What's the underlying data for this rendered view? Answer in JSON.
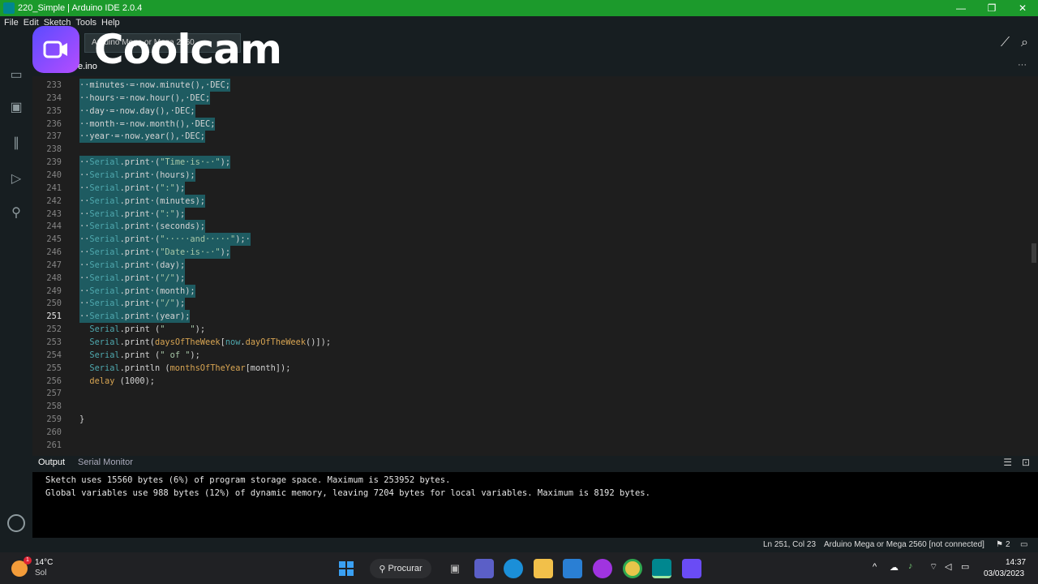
{
  "window": {
    "title": "220_Simple | Arduino IDE 2.0.4",
    "minimize": "—",
    "maximize": "❐",
    "close": "✕"
  },
  "menu": [
    "File",
    "Edit",
    "Sketch",
    "Tools",
    "Help"
  ],
  "toolbar": {
    "board_selected": "Arduino Mega or Mega 2560"
  },
  "watermark": {
    "text": "Coolcam"
  },
  "tab": {
    "label": "e.ino",
    "more": "···"
  },
  "editor": {
    "active_line": 251,
    "lines": [
      {
        "n": "233",
        "sel": true,
        "parts": [
          [
            "··minutes·=·",
            ""
          ],
          [
            "now",
            ""
          ],
          [
            ".minute(),·DEC;",
            ""
          ]
        ]
      },
      {
        "n": "234",
        "sel": true,
        "parts": [
          [
            "··hours·=·",
            ""
          ],
          [
            "now",
            ""
          ],
          [
            ".hour(),·DEC;",
            ""
          ]
        ]
      },
      {
        "n": "235",
        "sel": true,
        "parts": [
          [
            "··day·=·",
            ""
          ],
          [
            "now",
            ""
          ],
          [
            ".day(),·DEC;",
            ""
          ]
        ]
      },
      {
        "n": "236",
        "sel": true,
        "parts": [
          [
            "··month·=·",
            ""
          ],
          [
            "now",
            ""
          ],
          [
            ".month(),·DEC;",
            ""
          ]
        ]
      },
      {
        "n": "237",
        "sel": true,
        "parts": [
          [
            "··year·=·",
            ""
          ],
          [
            "now",
            ""
          ],
          [
            ".year(),·DEC;",
            ""
          ]
        ]
      },
      {
        "n": "238",
        "sel": true,
        "parts": [
          [
            "",
            ""
          ]
        ]
      },
      {
        "n": "239",
        "sel": true,
        "parts": [
          [
            "··",
            ""
          ],
          [
            "Serial",
            "o"
          ],
          [
            ".print·(",
            ""
          ],
          [
            "\"Time·is·-·\"",
            "s"
          ],
          [
            ");",
            ""
          ]
        ]
      },
      {
        "n": "240",
        "sel": true,
        "parts": [
          [
            "··",
            ""
          ],
          [
            "Serial",
            "o"
          ],
          [
            ".print·(hours);",
            ""
          ]
        ]
      },
      {
        "n": "241",
        "sel": true,
        "parts": [
          [
            "··",
            ""
          ],
          [
            "Serial",
            "o"
          ],
          [
            ".print·(",
            ""
          ],
          [
            "\":\"",
            "s"
          ],
          [
            ");",
            ""
          ]
        ]
      },
      {
        "n": "242",
        "sel": true,
        "parts": [
          [
            "··",
            ""
          ],
          [
            "Serial",
            "o"
          ],
          [
            ".print·(minutes);",
            ""
          ]
        ]
      },
      {
        "n": "243",
        "sel": true,
        "parts": [
          [
            "··",
            ""
          ],
          [
            "Serial",
            "o"
          ],
          [
            ".print·(",
            ""
          ],
          [
            "\":\"",
            "s"
          ],
          [
            ");",
            ""
          ]
        ]
      },
      {
        "n": "244",
        "sel": true,
        "parts": [
          [
            "··",
            ""
          ],
          [
            "Serial",
            "o"
          ],
          [
            ".print·(seconds);",
            ""
          ]
        ]
      },
      {
        "n": "245",
        "sel": true,
        "parts": [
          [
            "··",
            ""
          ],
          [
            "Serial",
            "o"
          ],
          [
            ".print·(",
            ""
          ],
          [
            "\"·····and·····\"",
            "s"
          ],
          [
            ");·",
            ""
          ]
        ]
      },
      {
        "n": "246",
        "sel": true,
        "parts": [
          [
            "··",
            ""
          ],
          [
            "Serial",
            "o"
          ],
          [
            ".print·(",
            ""
          ],
          [
            "\"Date·is·-·\"",
            "s"
          ],
          [
            ");",
            ""
          ]
        ]
      },
      {
        "n": "247",
        "sel": true,
        "parts": [
          [
            "··",
            ""
          ],
          [
            "Serial",
            "o"
          ],
          [
            ".print·(day);",
            ""
          ]
        ]
      },
      {
        "n": "248",
        "sel": true,
        "parts": [
          [
            "··",
            ""
          ],
          [
            "Serial",
            "o"
          ],
          [
            ".print·(",
            ""
          ],
          [
            "\"/\"",
            "s"
          ],
          [
            ");",
            ""
          ]
        ]
      },
      {
        "n": "249",
        "sel": true,
        "parts": [
          [
            "··",
            ""
          ],
          [
            "Serial",
            "o"
          ],
          [
            ".print·(month);",
            ""
          ]
        ]
      },
      {
        "n": "250",
        "sel": true,
        "parts": [
          [
            "··",
            ""
          ],
          [
            "Serial",
            "o"
          ],
          [
            ".print·(",
            ""
          ],
          [
            "\"/\"",
            "s"
          ],
          [
            ");",
            ""
          ]
        ]
      },
      {
        "n": "251",
        "sel": true,
        "parts": [
          [
            "··",
            ""
          ],
          [
            "Serial",
            "o"
          ],
          [
            ".print·(year);",
            ""
          ]
        ]
      },
      {
        "n": "252",
        "sel": false,
        "parts": [
          [
            "  ",
            ""
          ],
          [
            "Serial",
            "o"
          ],
          [
            ".print (",
            ""
          ],
          [
            "\"     \"",
            "s"
          ],
          [
            ");",
            ""
          ]
        ]
      },
      {
        "n": "253",
        "sel": false,
        "parts": [
          [
            "  ",
            ""
          ],
          [
            "Serial",
            "o"
          ],
          [
            ".print(",
            ""
          ],
          [
            "daysOfTheWeek",
            "f"
          ],
          [
            "[",
            ""
          ],
          [
            "now",
            "o"
          ],
          [
            ".",
            ""
          ],
          [
            "dayOfTheWeek",
            "f"
          ],
          [
            "()]);",
            ""
          ]
        ]
      },
      {
        "n": "254",
        "sel": false,
        "parts": [
          [
            "  ",
            ""
          ],
          [
            "Serial",
            "o"
          ],
          [
            ".print (",
            ""
          ],
          [
            "\" of \"",
            "s"
          ],
          [
            ");",
            ""
          ]
        ]
      },
      {
        "n": "255",
        "sel": false,
        "parts": [
          [
            "  ",
            ""
          ],
          [
            "Serial",
            "o"
          ],
          [
            ".println (",
            ""
          ],
          [
            "monthsOfTheYear",
            "f"
          ],
          [
            "[month]);",
            ""
          ]
        ]
      },
      {
        "n": "256",
        "sel": false,
        "parts": [
          [
            "  ",
            ""
          ],
          [
            "delay",
            "f"
          ],
          [
            " (1000);",
            ""
          ]
        ]
      },
      {
        "n": "257",
        "sel": false,
        "parts": [
          [
            "",
            ""
          ]
        ]
      },
      {
        "n": "258",
        "sel": false,
        "parts": [
          [
            "",
            ""
          ]
        ]
      },
      {
        "n": "259",
        "sel": false,
        "parts": [
          [
            "}",
            ""
          ]
        ]
      },
      {
        "n": "260",
        "sel": false,
        "parts": [
          [
            "",
            ""
          ]
        ]
      },
      {
        "n": "261",
        "sel": false,
        "parts": [
          [
            "",
            ""
          ]
        ]
      }
    ]
  },
  "panel": {
    "tab_output": "Output",
    "tab_serial": "Serial Monitor",
    "output_lines": [
      "Sketch uses 15560 bytes (6%) of program storage space. Maximum is 253952 bytes.",
      "Global variables use 988 bytes (12%) of dynamic memory, leaving 7204 bytes for local variables. Maximum is 8192 bytes."
    ]
  },
  "status": {
    "cursor": "Ln 251, Col 23",
    "board": "Arduino Mega or Mega 2560 [not connected]",
    "notifications": "2"
  },
  "taskbar": {
    "weather_temp": "14°C",
    "weather_desc": "Sol",
    "search": "Procurar",
    "time": "14:37",
    "date": "03/03/2023",
    "weather_badge": "1"
  }
}
